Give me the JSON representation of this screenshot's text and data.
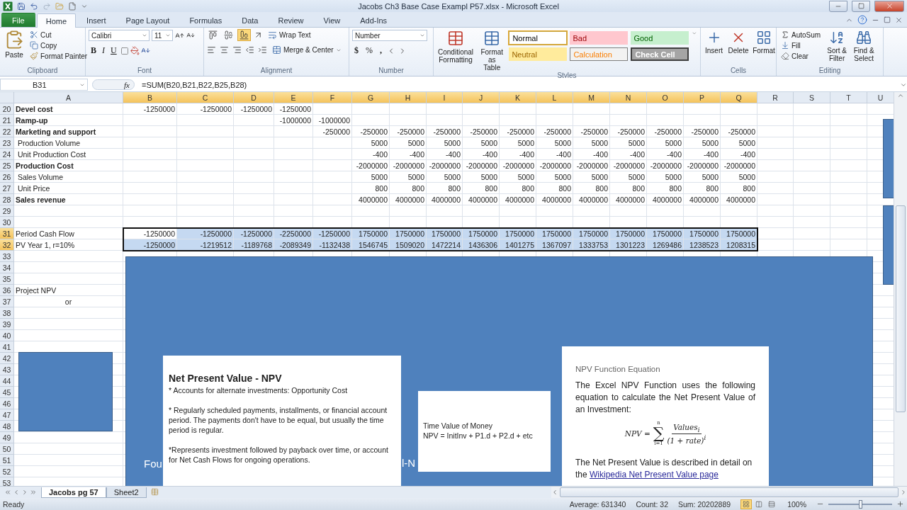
{
  "window": {
    "title": "Jacobs Ch3 Base Case Exampl P57.xlsx  -  Microsoft Excel"
  },
  "tabs": [
    {
      "label": "File",
      "kind": "file",
      "selected": false
    },
    {
      "label": "Home",
      "kind": "tab",
      "selected": true
    },
    {
      "label": "Insert",
      "kind": "tab",
      "selected": false
    },
    {
      "label": "Page Layout",
      "kind": "tab",
      "selected": false
    },
    {
      "label": "Formulas",
      "kind": "tab",
      "selected": false
    },
    {
      "label": "Data",
      "kind": "tab",
      "selected": false
    },
    {
      "label": "Review",
      "kind": "tab",
      "selected": false
    },
    {
      "label": "View",
      "kind": "tab",
      "selected": false
    },
    {
      "label": "Add-Ins",
      "kind": "tab",
      "selected": false
    }
  ],
  "ribbon": {
    "clipboard": {
      "label": "Clipboard",
      "paste": "Paste",
      "cut": "Cut",
      "copy": "Copy",
      "format_painter": "Format Painter"
    },
    "font": {
      "label": "Font",
      "name": "Calibri",
      "size": "11",
      "bold": "B",
      "italic": "I",
      "underline": "U"
    },
    "alignment": {
      "label": "Alignment",
      "wrap": "Wrap Text",
      "merge": "Merge & Center",
      "vertical_align": [
        {
          "selected": false
        },
        {
          "selected": false
        },
        {
          "selected": true
        }
      ]
    },
    "number": {
      "label": "Number",
      "format": "Number",
      "currency": "$",
      "percent": "%",
      "comma": ","
    },
    "styles": {
      "label": "Styles",
      "conditional": "Conditional Formatting",
      "table": "Format as Table",
      "cells": [
        {
          "label": "Normal",
          "kind": "normal",
          "selected": true
        },
        {
          "label": "Bad",
          "kind": "bad",
          "selected": false
        },
        {
          "label": "Good",
          "kind": "good",
          "selected": false
        },
        {
          "label": "Neutral",
          "kind": "neutral",
          "selected": false
        },
        {
          "label": "Calculation",
          "kind": "calculation",
          "selected": false
        },
        {
          "label": "Check Cell",
          "kind": "check",
          "selected": false
        }
      ]
    },
    "cells": {
      "label": "Cells",
      "insert": "Insert",
      "delete": "Delete",
      "format": "Format"
    },
    "editing": {
      "label": "Editing",
      "autosum": "AutoSum",
      "fill": "Fill",
      "clear": "Clear",
      "sort": "Sort & Filter",
      "find": "Find & Select"
    }
  },
  "formula_bar": {
    "name_box": "B31",
    "fx": "fx",
    "formula": "=SUM(B20,B21,B22,B25,B28)"
  },
  "columns": [
    {
      "label": "A",
      "selected": false
    },
    {
      "label": "B",
      "selected": true
    },
    {
      "label": "C",
      "selected": true
    },
    {
      "label": "D",
      "selected": true
    },
    {
      "label": "E",
      "selected": true
    },
    {
      "label": "F",
      "selected": true
    },
    {
      "label": "G",
      "selected": true
    },
    {
      "label": "H",
      "selected": true
    },
    {
      "label": "I",
      "selected": true
    },
    {
      "label": "J",
      "selected": true
    },
    {
      "label": "K",
      "selected": true
    },
    {
      "label": "L",
      "selected": true
    },
    {
      "label": "M",
      "selected": true
    },
    {
      "label": "N",
      "selected": true
    },
    {
      "label": "O",
      "selected": true
    },
    {
      "label": "P",
      "selected": true
    },
    {
      "label": "Q",
      "selected": true
    },
    {
      "label": "R",
      "selected": false
    },
    {
      "label": "S",
      "selected": false
    },
    {
      "label": "T",
      "selected": false
    },
    {
      "label": "U",
      "selected": false
    }
  ],
  "rows": [
    {
      "number": "20",
      "label": "Devel cost",
      "bold": true,
      "centered": false,
      "selected": false,
      "cells": {
        "c1": "-1250000",
        "c2": "-1250000",
        "c3": "-1250000",
        "c4": "-1250000"
      }
    },
    {
      "number": "21",
      "label": "Ramp-up",
      "bold": true,
      "centered": false,
      "selected": false,
      "cells": {
        "c4": "-1000000",
        "c5": "-1000000"
      }
    },
    {
      "number": "22",
      "label": "Marketing and support",
      "bold": true,
      "centered": false,
      "selected": false,
      "cells": {
        "c5": "-250000",
        "c6": "-250000",
        "c7": "-250000",
        "c8": "-250000",
        "c9": "-250000",
        "c10": "-250000",
        "c11": "-250000",
        "c12": "-250000",
        "c13": "-250000",
        "c14": "-250000",
        "c15": "-250000",
        "c16": "-250000"
      }
    },
    {
      "number": "23",
      "label": " Production Volume",
      "bold": false,
      "centered": false,
      "selected": false,
      "cells": {
        "c6": "5000",
        "c7": "5000",
        "c8": "5000",
        "c9": "5000",
        "c10": "5000",
        "c11": "5000",
        "c12": "5000",
        "c13": "5000",
        "c14": "5000",
        "c15": "5000",
        "c16": "5000"
      }
    },
    {
      "number": "24",
      "label": " Unit Production Cost",
      "bold": false,
      "centered": false,
      "selected": false,
      "cells": {
        "c6": "-400",
        "c7": "-400",
        "c8": "-400",
        "c9": "-400",
        "c10": "-400",
        "c11": "-400",
        "c12": "-400",
        "c13": "-400",
        "c14": "-400",
        "c15": "-400",
        "c16": "-400"
      }
    },
    {
      "number": "25",
      "label": "Production Cost",
      "bold": true,
      "centered": false,
      "selected": false,
      "cells": {
        "c6": "-2000000",
        "c7": "-2000000",
        "c8": "-2000000",
        "c9": "-2000000",
        "c10": "-2000000",
        "c11": "-2000000",
        "c12": "-2000000",
        "c13": "-2000000",
        "c14": "-2000000",
        "c15": "-2000000",
        "c16": "-2000000"
      }
    },
    {
      "number": "26",
      "label": " Sales Volume",
      "bold": false,
      "centered": false,
      "selected": false,
      "cells": {
        "c6": "5000",
        "c7": "5000",
        "c8": "5000",
        "c9": "5000",
        "c10": "5000",
        "c11": "5000",
        "c12": "5000",
        "c13": "5000",
        "c14": "5000",
        "c15": "5000",
        "c16": "5000"
      }
    },
    {
      "number": "27",
      "label": " Unit Price",
      "bold": false,
      "centered": false,
      "selected": false,
      "cells": {
        "c6": "800",
        "c7": "800",
        "c8": "800",
        "c9": "800",
        "c10": "800",
        "c11": "800",
        "c12": "800",
        "c13": "800",
        "c14": "800",
        "c15": "800",
        "c16": "800"
      }
    },
    {
      "number": "28",
      "label": "Sales revenue",
      "bold": true,
      "centered": false,
      "selected": false,
      "cells": {
        "c6": "4000000",
        "c7": "4000000",
        "c8": "4000000",
        "c9": "4000000",
        "c10": "4000000",
        "c11": "4000000",
        "c12": "4000000",
        "c13": "4000000",
        "c14": "4000000",
        "c15": "4000000",
        "c16": "4000000"
      }
    },
    {
      "number": "29",
      "selected": false
    },
    {
      "number": "30",
      "selected": false
    },
    {
      "number": "31",
      "label": "Period Cash Flow",
      "bold": false,
      "centered": false,
      "selected": true,
      "active": true,
      "cells": {
        "c1": "-1250000",
        "c2": "-1250000",
        "c3": "-1250000",
        "c4": "-2250000",
        "c5": "-1250000",
        "c6": "1750000",
        "c7": "1750000",
        "c8": "1750000",
        "c9": "1750000",
        "c10": "1750000",
        "c11": "1750000",
        "c12": "1750000",
        "c13": "1750000",
        "c14": "1750000",
        "c15": "1750000",
        "c16": "1750000"
      }
    },
    {
      "number": "32",
      "label": "PV Year 1, r=10%",
      "bold": false,
      "centered": false,
      "selected": true,
      "active": false,
      "cells": {
        "c1": "-1250000",
        "c2": "-1219512",
        "c3": "-1189768",
        "c4": "-2089349",
        "c5": "-1132438",
        "c6": "1546745",
        "c7": "1509020",
        "c8": "1472214",
        "c9": "1436306",
        "c10": "1401275",
        "c11": "1367097",
        "c12": "1333753",
        "c13": "1301223",
        "c14": "1269486",
        "c15": "1238523",
        "c16": "1208315"
      }
    },
    {
      "number": "33",
      "selected": false
    },
    {
      "number": "34",
      "selected": false
    },
    {
      "number": "35",
      "selected": false
    },
    {
      "number": "36",
      "label": "Project NPV",
      "bold": false,
      "centered": false,
      "selected": false
    },
    {
      "number": "37",
      "label": "or",
      "bold": false,
      "centered": true,
      "selected": false
    },
    {
      "number": "38",
      "selected": false
    },
    {
      "number": "39",
      "selected": false
    },
    {
      "number": "40",
      "selected": false
    },
    {
      "number": "41",
      "selected": false
    },
    {
      "number": "42",
      "selected": false
    },
    {
      "number": "43",
      "selected": false
    },
    {
      "number": "44",
      "selected": false
    },
    {
      "number": "45",
      "selected": false
    },
    {
      "number": "46",
      "selected": false
    },
    {
      "number": "47",
      "selected": false
    },
    {
      "number": "48",
      "selected": false
    },
    {
      "number": "49",
      "selected": false
    },
    {
      "number": "50",
      "selected": false
    },
    {
      "number": "51",
      "selected": false
    },
    {
      "number": "52",
      "selected": false
    },
    {
      "number": "53",
      "selected": false
    }
  ],
  "shape_text_fragments": [
    "Fou",
    "l-N"
  ],
  "npv_box": {
    "title": "Net Present Value - NPV",
    "paragraphs": [
      "* Accounts for alternate investments: Opportunity Cost",
      "* Regularly scheduled payments, installments, or financial account period. The payments don't have to be equal, but usually the time period is regular.",
      "*Represents investment followed by payback over time, or account for Net Cash Flows for  ongoing operations."
    ]
  },
  "time_box": {
    "lines": [
      "Time Value of Money",
      "NPV = InitInv + P1.d + P2.d + etc"
    ]
  },
  "function_box": {
    "heading": "NPV Function Equation",
    "intro": "The Excel NPV Function uses the following equation to calculate the Net Present Value of an Investment:",
    "equation": {
      "lhs": "NPV =",
      "sigma": "∑",
      "top": "n",
      "bottom": "i=1",
      "numerator": "Values$_{i}$",
      "denominator": "(1 + rate)$^{i}$"
    },
    "outro": "The Net Present Value is described in detail on the",
    "link": "Wikipedia Net Present Value page"
  },
  "sheet_tabs": [
    {
      "label": "Jacobs pg 57",
      "selected": true
    },
    {
      "label": "Sheet2",
      "selected": false
    }
  ],
  "status_bar": {
    "mode": "Ready",
    "average": "Average: 631340",
    "count": "Count: 32",
    "sum": "Sum: 20202889",
    "views": [
      {
        "kind": "normal",
        "selected": true
      },
      {
        "kind": "layout",
        "selected": false
      },
      {
        "kind": "pagebreak",
        "selected": false
      }
    ],
    "zoom": "100%",
    "zoom_level": {
      "level": 0.5
    }
  }
}
